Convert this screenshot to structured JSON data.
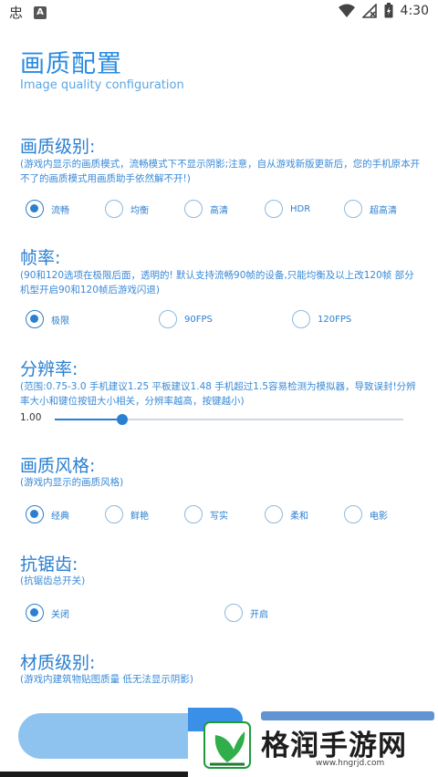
{
  "status_bar": {
    "time": "4:30",
    "left_glyph": "忠",
    "notif_badge": "A",
    "icons": [
      "wifi-icon",
      "signal-off-icon",
      "battery-charging-icon"
    ]
  },
  "header": {
    "title": "画质配置",
    "subtitle": "Image quality configuration"
  },
  "quality_level": {
    "title": "画质级别:",
    "desc": "(游戏内显示的画质模式，流畅模式下不显示阴影;注意，自从游戏新版更新后，您的手机原本开不了的画质模式用画质助手依然解不开!)",
    "options": [
      "流畅",
      "均衡",
      "高清",
      "HDR",
      "超高清"
    ],
    "selected": "流畅"
  },
  "frame_rate": {
    "title": "帧率:",
    "desc": "(90和120选项在极限后面，透明的! 默认支持流畅90帧的设备,只能均衡及以上改120帧 部分机型开启90和120帧后游戏闪退)",
    "options": [
      "极限",
      "90FPS",
      "120FPS"
    ],
    "selected": "极限"
  },
  "resolution": {
    "title": "分辨率:",
    "desc": "(范围:0.75-3.0 手机建议1.25 平板建议1.48 手机超过1.5容易检测为模拟器，导致误封!分辨率大小和键位按钮大小相关，分辨率越高，按键越小)",
    "value": "1.00",
    "min": 0.75,
    "max": 3.0,
    "current": 1.0
  },
  "style": {
    "title": "画质风格:",
    "desc": "(游戏内显示的画质风格)",
    "options": [
      "经典",
      "鲜艳",
      "写实",
      "柔和",
      "电影"
    ],
    "selected": "经典"
  },
  "antialias": {
    "title": "抗锯齿:",
    "desc": "(抗锯齿总开关)",
    "options": [
      "关闭",
      "开启"
    ],
    "selected": "关闭"
  },
  "material": {
    "title": "材质级别:",
    "desc": "(游戏内建筑物贴图质量 低无法显示阴影)"
  },
  "watermark": {
    "text": "格润手游网",
    "url": "www.hngrjd.com"
  },
  "colors": {
    "accent": "#2a7fd0",
    "title": "#2a8be0",
    "button": "#8ec3ef"
  }
}
